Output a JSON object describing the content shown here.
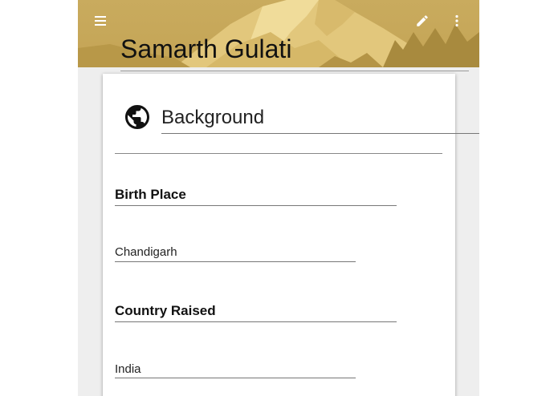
{
  "header": {
    "name": "Samarth Gulati",
    "menu_icon": "menu-icon",
    "edit_icon": "edit-icon",
    "more_icon": "more-vert-icon"
  },
  "section": {
    "icon": "globe-icon",
    "title": "Background"
  },
  "fields": [
    {
      "label": "Birth Place",
      "value": "Chandigarh"
    },
    {
      "label": "Country Raised",
      "value": "India"
    }
  ]
}
